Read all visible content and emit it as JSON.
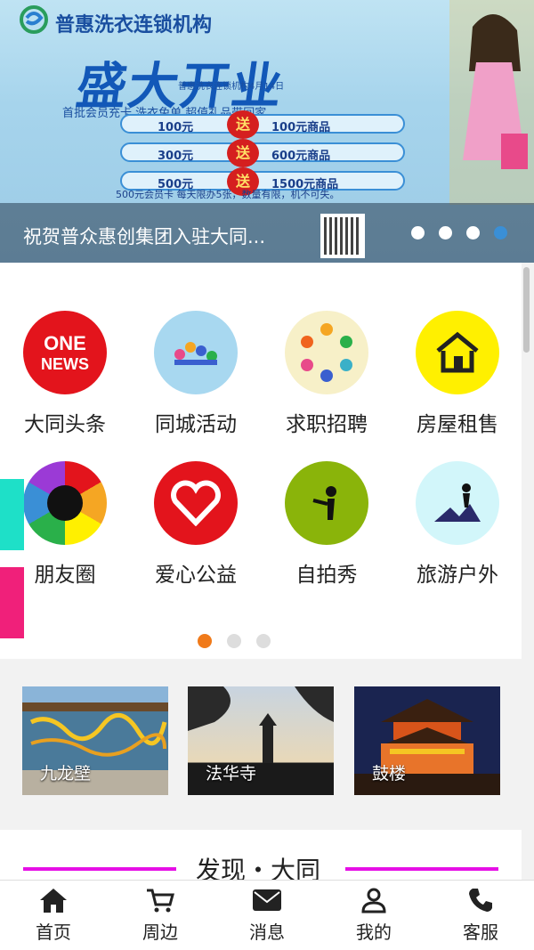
{
  "banner": {
    "brand": "普惠洗衣连锁机构",
    "headline": "盛大开业",
    "subline": "普惠洗衣连锁机构4月14日",
    "promo": "首批会员充卡   洗衣免单   超值礼品带回家",
    "rows": [
      {
        "left": "100元",
        "send": "送",
        "right": "100元商品"
      },
      {
        "left": "300元",
        "send": "送",
        "right": "600元商品"
      },
      {
        "left": "500元",
        "send": "送",
        "right": "1500元商品"
      }
    ],
    "note": "500元会员卡 每天限办5张，数量有限，机不可失。",
    "caption": "祝贺普众惠创集团入驻大同...",
    "slide_count": 4,
    "active_slide": 3
  },
  "grid": {
    "items": [
      {
        "label": "大同头条",
        "icon": "one-news-icon",
        "logo_text": "ONE NEWS"
      },
      {
        "label": "同城活动",
        "icon": "people-stars-icon"
      },
      {
        "label": "求职招聘",
        "icon": "people-ring-icon"
      },
      {
        "label": "房屋租售",
        "icon": "house-icon"
      },
      {
        "label": "朋友圈",
        "icon": "aperture-icon"
      },
      {
        "label": "爱心公益",
        "icon": "heart-icon"
      },
      {
        "label": "自拍秀",
        "icon": "selfie-icon"
      },
      {
        "label": "旅游户外",
        "icon": "hiker-icon"
      }
    ],
    "page_count": 3,
    "active_page": 0
  },
  "scenic": [
    {
      "label": "九龙壁"
    },
    {
      "label": "法华寺"
    },
    {
      "label": "鼓楼"
    }
  ],
  "discover": {
    "title": "发现・大同"
  },
  "nav": [
    {
      "label": "首页",
      "icon": "home-icon"
    },
    {
      "label": "周边",
      "icon": "cart-icon"
    },
    {
      "label": "消息",
      "icon": "mail-icon"
    },
    {
      "label": "我的",
      "icon": "user-icon"
    },
    {
      "label": "客服",
      "icon": "phone-icon"
    }
  ],
  "colors": {
    "accent": "#f07a1a",
    "discover_line": "#e60fe6",
    "side_tab_top": "#1ee0c8",
    "side_tab_bottom": "#f0207a"
  }
}
